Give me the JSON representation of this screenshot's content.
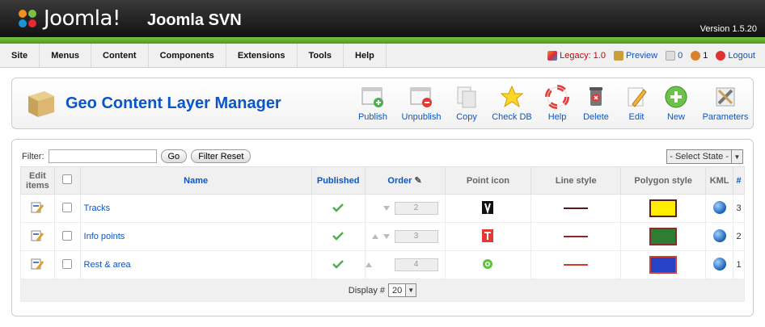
{
  "header": {
    "logo_text": "Joomla!",
    "site_name": "Joomla SVN",
    "version": "Version 1.5.20"
  },
  "menu": [
    "Site",
    "Menus",
    "Content",
    "Components",
    "Extensions",
    "Tools",
    "Help"
  ],
  "status": {
    "legacy": "Legacy: 1.0",
    "preview": "Preview",
    "messages": "0",
    "users": "1",
    "logout": "Logout"
  },
  "page_title": "Geo Content Layer Manager",
  "toolbar": [
    {
      "label": "Publish",
      "icon": "publish-icon"
    },
    {
      "label": "Unpublish",
      "icon": "unpublish-icon"
    },
    {
      "label": "Copy",
      "icon": "copy-icon"
    },
    {
      "label": "Check DB",
      "icon": "star-icon"
    },
    {
      "label": "Help",
      "icon": "lifebuoy-icon"
    },
    {
      "label": "Delete",
      "icon": "trash-icon"
    },
    {
      "label": "Edit",
      "icon": "pencil-icon"
    },
    {
      "label": "New",
      "icon": "plus-icon"
    },
    {
      "label": "Parameters",
      "icon": "tools-icon"
    }
  ],
  "filter": {
    "label": "Filter:",
    "value": "",
    "go": "Go",
    "reset": "Filter Reset",
    "state_select": "- Select State -"
  },
  "columns": {
    "edit": "Edit items",
    "name": "Name",
    "published": "Published",
    "order": "Order",
    "point_icon": "Point icon",
    "line_style": "Line style",
    "polygon_style": "Polygon style",
    "kml": "KML",
    "id": "#"
  },
  "rows": [
    {
      "name": "Tracks",
      "order": "2",
      "id": "3",
      "line_color": "#5a1a1a",
      "poly_fill": "#ffee00",
      "poly_border": "#5a1a1a"
    },
    {
      "name": "Info points",
      "order": "3",
      "id": "2",
      "line_color": "#8b2a2a",
      "poly_fill": "#2e7d32",
      "poly_border": "#8b2a2a"
    },
    {
      "name": "Rest & area",
      "order": "4",
      "id": "1",
      "line_color": "#d23c2c",
      "poly_fill": "#2843c8",
      "poly_border": "#d23c2c"
    }
  ],
  "footer": {
    "display_label": "Display #",
    "display_value": "20"
  }
}
